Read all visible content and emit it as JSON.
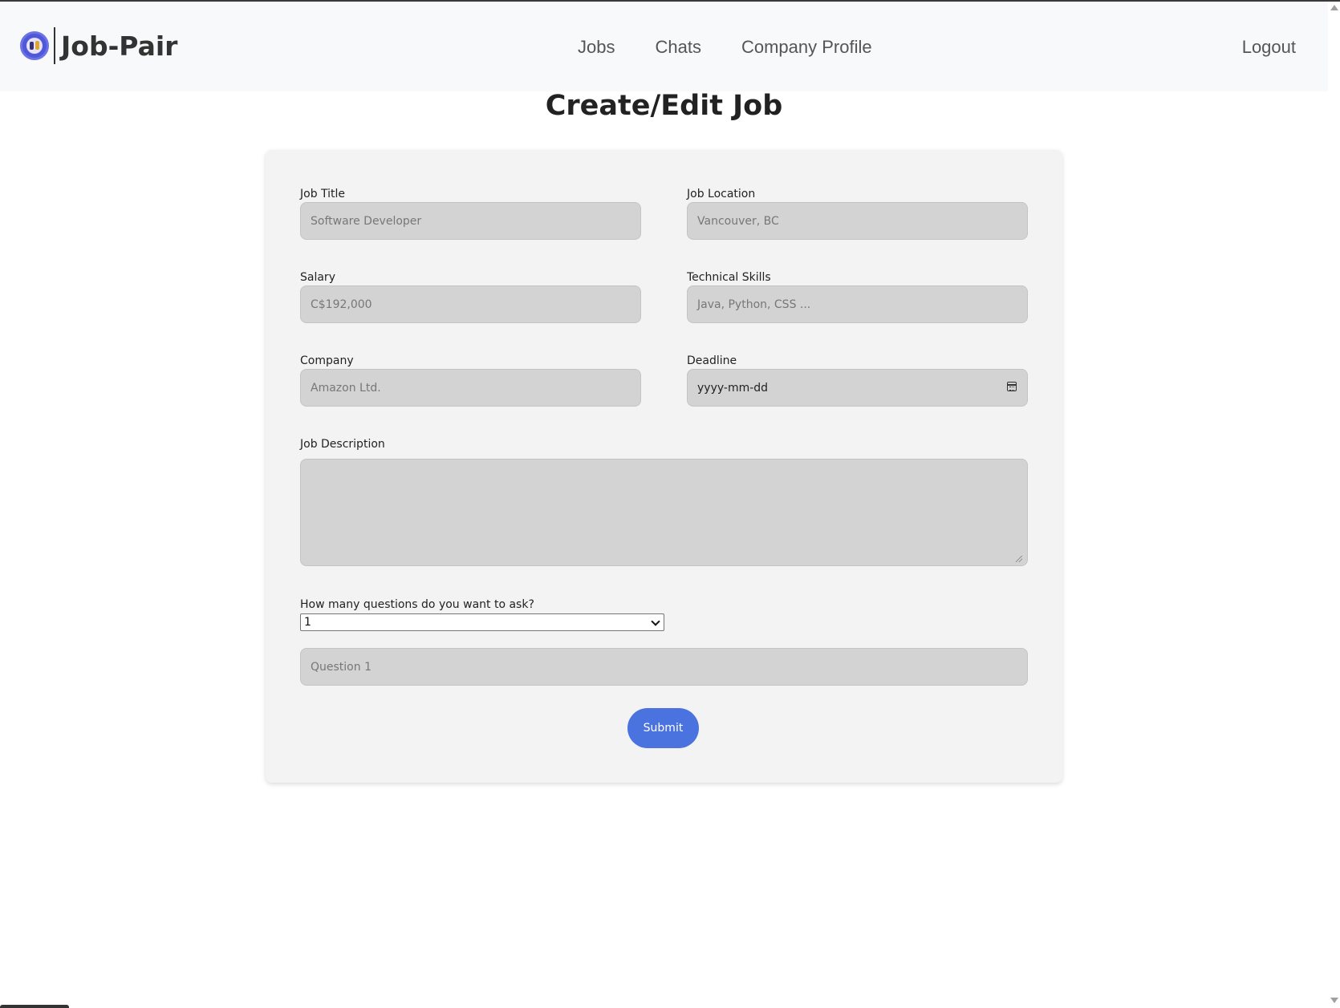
{
  "brand": {
    "logo_icon": "job-pair-logo-icon",
    "name": "Job-Pair"
  },
  "nav": {
    "items": [
      {
        "label": "Jobs"
      },
      {
        "label": "Chats"
      },
      {
        "label": "Company Profile"
      }
    ],
    "logout_label": "Logout"
  },
  "page": {
    "title": "Create/Edit Job"
  },
  "form": {
    "job_title": {
      "label": "Job Title",
      "placeholder": "Software Developer"
    },
    "job_location": {
      "label": "Job Location",
      "placeholder": "Vancouver, BC"
    },
    "salary": {
      "label": "Salary",
      "placeholder": "C$192,000"
    },
    "technical_skills": {
      "label": "Technical Skills",
      "placeholder": "Java, Python, CSS ..."
    },
    "company": {
      "label": "Company",
      "placeholder": "Amazon Ltd."
    },
    "deadline": {
      "label": "Deadline",
      "value": "yyyy-mm-dd",
      "icon": "calendar-icon"
    },
    "job_description": {
      "label": "Job Description",
      "value": ""
    },
    "question_count": {
      "label": "How many questions do you want to ask?",
      "selected": "1"
    },
    "question_1": {
      "placeholder": "Question 1"
    },
    "submit_label": "Submit"
  },
  "colors": {
    "accent": "#4a73e0",
    "input_bg": "#d3d3d3",
    "card_bg": "#f3f3f3",
    "navbar_bg": "#f8f9fa"
  }
}
